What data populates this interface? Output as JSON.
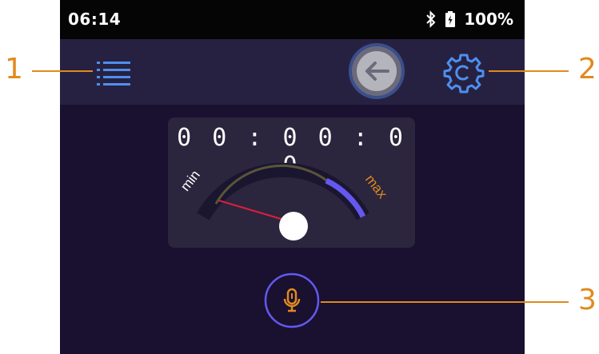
{
  "status_bar": {
    "time": "06:14",
    "bluetooth_icon": "bluetooth-icon",
    "battery_icon": "battery-icon",
    "battery_percent": "100%"
  },
  "toolbar": {
    "menu_icon": "list-menu-icon",
    "back_icon": "arrow-left-icon",
    "settings_icon": "gear-icon"
  },
  "meter": {
    "timer": "00:00:00",
    "min_label": "min",
    "max_label": "max",
    "level_fraction": 0.0
  },
  "mic_button": {
    "icon": "microphone-icon"
  },
  "callouts": {
    "one": "1",
    "two": "2",
    "three": "3"
  },
  "colors": {
    "screen_bg": "#1a1030",
    "toolbar_bg": "#272141",
    "accent_blue": "#4e8ff0",
    "accent_orange": "#e08a1e",
    "gauge_purple": "#6458f0",
    "needle_red": "#e01e3c"
  }
}
